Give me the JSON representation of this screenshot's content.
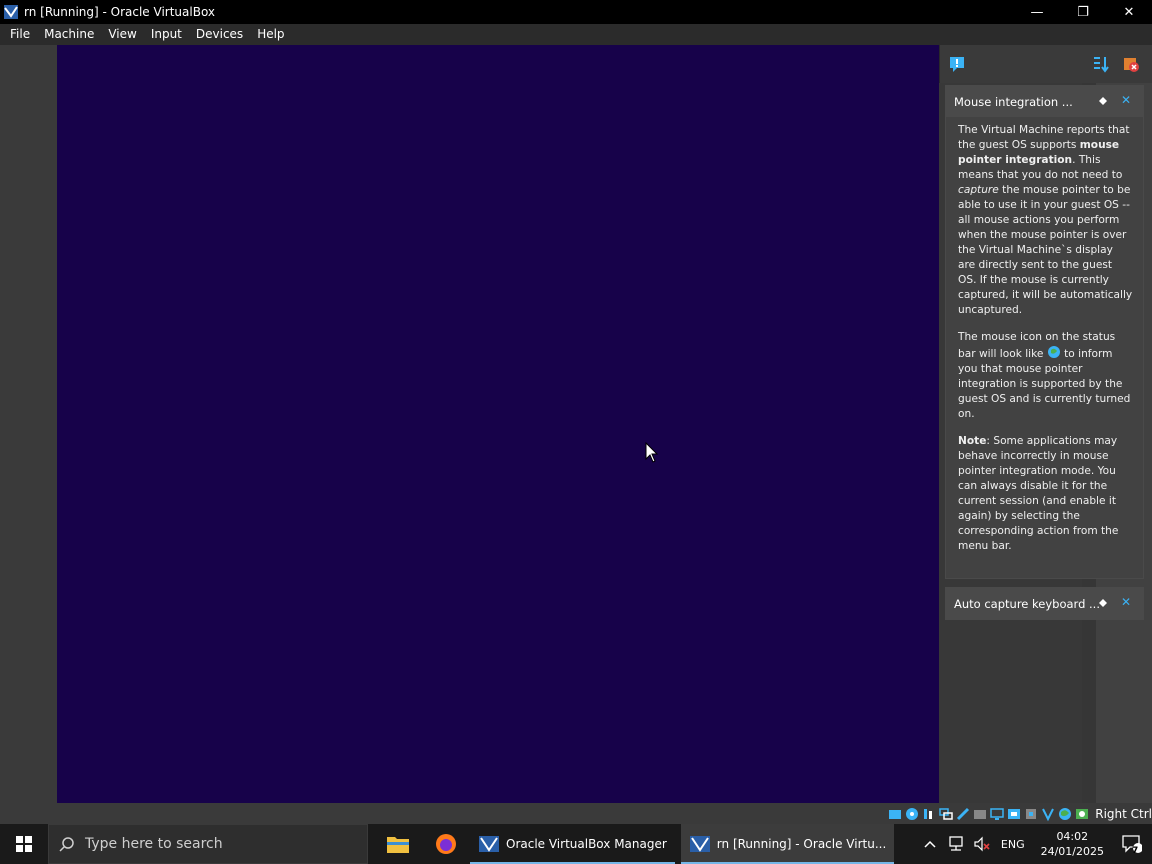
{
  "window": {
    "title": "rn [Running] - Oracle VirtualBox",
    "controls": {
      "minimize": "—",
      "restore": "❐",
      "close": "✕"
    }
  },
  "menu": [
    "File",
    "Machine",
    "View",
    "Input",
    "Devices",
    "Help"
  ],
  "colors": {
    "vm_screen": "#17024a",
    "accent": "#3bb3f5"
  },
  "notifications": [
    {
      "title": "Mouse integration ...",
      "body": {
        "p1_a": "The Virtual Machine reports that the guest OS supports ",
        "p1_b": "mouse pointer integration",
        "p1_c": ". This means that you do not need to ",
        "p1_d": "capture",
        "p1_e": " the mouse pointer to be able to use it in your guest OS -- all mouse actions you perform when the mouse pointer is over the Virtual Machine`s display are directly sent to the guest OS. If the mouse is currently captured, it will be automatically uncaptured.",
        "p2_a": "The mouse icon on the status bar will look like ",
        "p2_b": " to inform you that mouse pointer integration is supported by the guest OS and is currently turned on.",
        "p3_a": "Note",
        "p3_b": ": Some applications may behave incorrectly in mouse pointer integration mode. You can always disable it for the current session (and enable it again) by selecting the corresponding action from the menu bar."
      }
    },
    {
      "title": "Auto capture keyboard ..."
    }
  ],
  "statusbar": {
    "host_key": "Right Ctrl"
  },
  "taskbar": {
    "search_placeholder": "Type here to search",
    "apps": [
      {
        "label": "Oracle VirtualBox Manager"
      },
      {
        "label": "rn [Running] - Oracle Virtu..."
      }
    ],
    "tray": {
      "language": "ENG",
      "time": "04:02",
      "date": "24/01/2025",
      "notification_count": "7"
    }
  }
}
